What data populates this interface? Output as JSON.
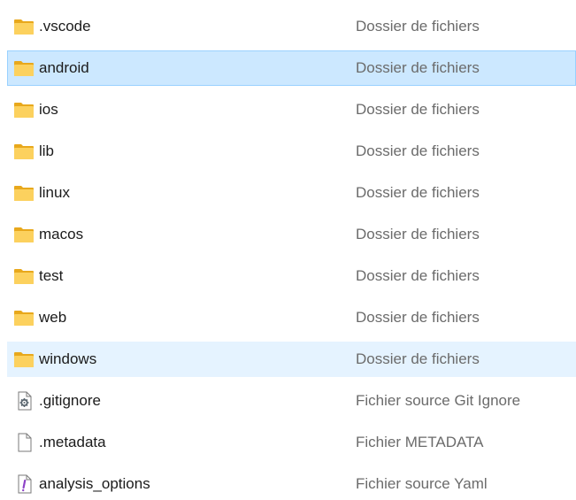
{
  "files": [
    {
      "name": ".vscode",
      "type": "Dossier de fichiers",
      "icon": "folder-icon",
      "state": "normal"
    },
    {
      "name": "android",
      "type": "Dossier de fichiers",
      "icon": "folder-icon",
      "state": "selected"
    },
    {
      "name": "ios",
      "type": "Dossier de fichiers",
      "icon": "folder-icon",
      "state": "normal"
    },
    {
      "name": "lib",
      "type": "Dossier de fichiers",
      "icon": "folder-icon",
      "state": "normal"
    },
    {
      "name": "linux",
      "type": "Dossier de fichiers",
      "icon": "folder-icon",
      "state": "normal"
    },
    {
      "name": "macos",
      "type": "Dossier de fichiers",
      "icon": "folder-icon",
      "state": "normal"
    },
    {
      "name": "test",
      "type": "Dossier de fichiers",
      "icon": "folder-icon",
      "state": "normal"
    },
    {
      "name": "web",
      "type": "Dossier de fichiers",
      "icon": "folder-icon",
      "state": "normal"
    },
    {
      "name": "windows",
      "type": "Dossier de fichiers",
      "icon": "folder-icon",
      "state": "hover"
    },
    {
      "name": ".gitignore",
      "type": "Fichier source Git Ignore",
      "icon": "config-file-icon",
      "state": "normal"
    },
    {
      "name": ".metadata",
      "type": "Fichier METADATA",
      "icon": "blank-file-icon",
      "state": "normal"
    },
    {
      "name": "analysis_options",
      "type": "Fichier source Yaml",
      "icon": "yaml-file-icon",
      "state": "normal"
    }
  ],
  "colors": {
    "selected_bg": "#cce8ff",
    "selected_border": "#99d1ff",
    "hover_bg": "#e5f3ff",
    "folder": "#f8c64a",
    "type_text": "#6b6b6b"
  }
}
